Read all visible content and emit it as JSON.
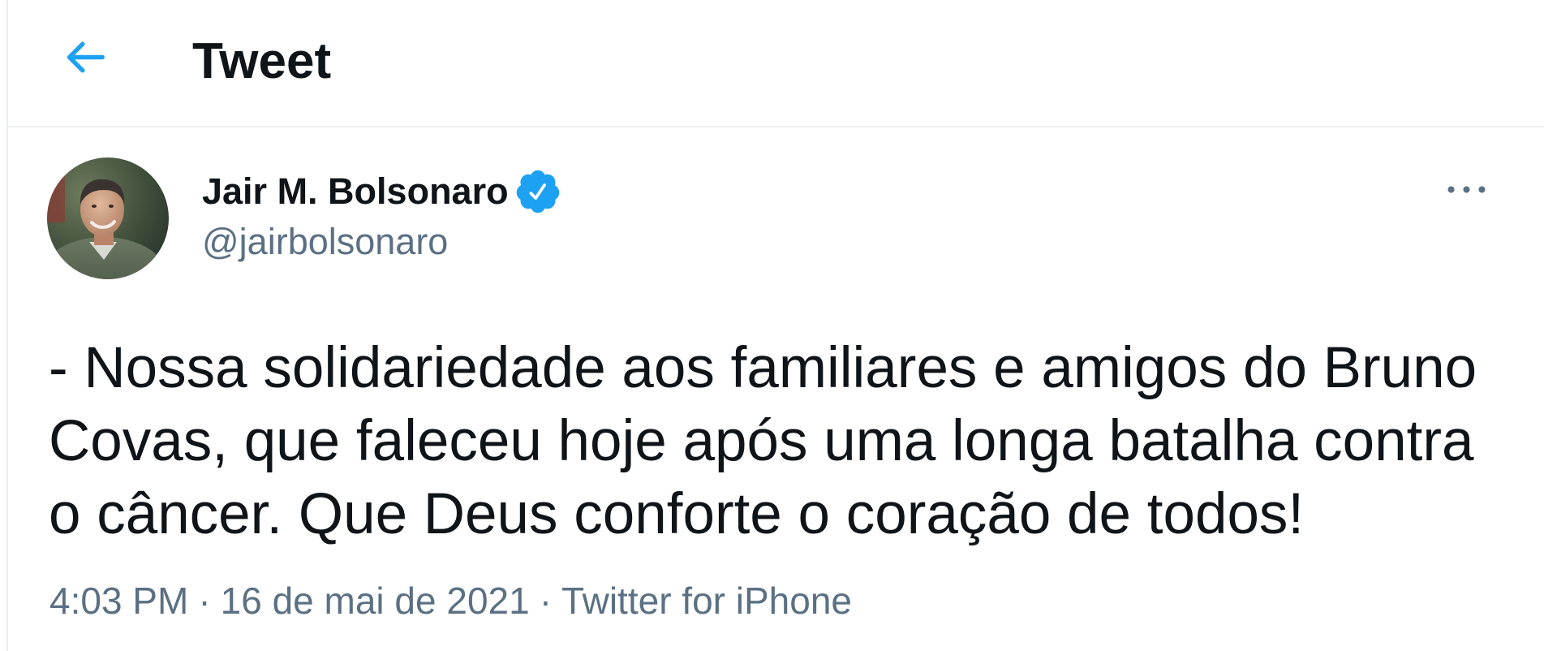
{
  "header": {
    "title": "Tweet",
    "back_icon": "arrow-left-icon"
  },
  "tweet": {
    "author": {
      "name": "Jair M. Bolsonaro",
      "handle": "@jairbolsonaro",
      "verified": true,
      "verified_icon": "verified-badge-icon",
      "avatar_icon": "avatar-photo"
    },
    "more_icon": "more-options-icon",
    "text_lines": [
      "- Nossa solidariedade aos familiares e amigos do Bruno",
      "Covas, que faleceu hoje após uma longa batalha contra",
      "o câncer. Que Deus conforte o coração de todos!"
    ],
    "meta": {
      "time": "4:03 PM",
      "separator": "·",
      "date": "16 de mai de 2021",
      "source": "Twitter for iPhone"
    }
  },
  "colors": {
    "accent": "#1da1f2",
    "text": "#0f1419",
    "secondary": "#5b7083",
    "divider": "#ebeef0",
    "background": "#ffffff"
  }
}
